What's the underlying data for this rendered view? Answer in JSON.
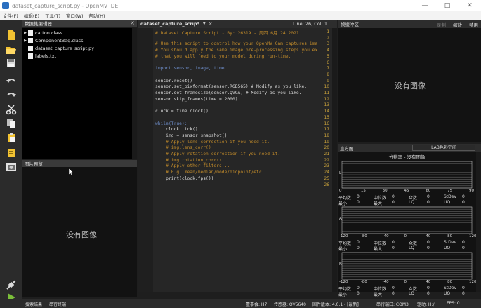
{
  "window": {
    "title": "dataset_capture_script.py - OpenMV IDE"
  },
  "menu": [
    "文件(F)",
    "编辑(E)",
    "工具(T)",
    "窗口(W)",
    "帮助(H)"
  ],
  "file_browser": {
    "header": "数据集编辑器",
    "items": [
      {
        "name": "carton.class",
        "folder": true
      },
      {
        "name": "ComponentBag.class",
        "folder": true
      },
      {
        "name": "dataset_capture_script.py",
        "folder": false
      },
      {
        "name": "labels.txt",
        "folder": false
      }
    ]
  },
  "image_preview": {
    "header": "图片预览",
    "no_image": "没有图像"
  },
  "editor": {
    "tab_label": "dataset_capture_scrip*",
    "line_col": "Line: 26, Col: 1",
    "lines": [
      "# Dataset Capture Script - By: 26319 - 周四 6月 24 2021",
      "",
      "# Use this script to control how your OpenMV Cam captures ima",
      "# You should apply the same image pre-processing steps you ex",
      "# that you will feed to your model during run-time.",
      "",
      "import sensor, image, time",
      "",
      "sensor.reset()",
      "sensor.set_pixformat(sensor.RGB565) # Modify as you like.",
      "sensor.set_framesize(sensor.QVGA) # Modify as you like.",
      "sensor.skip_frames(time = 2000)",
      "",
      "clock = time.clock()",
      "",
      "while(True):",
      "    clock.tick()",
      "    img = sensor.snapshot()",
      "    # Apply lens correction if you need it.",
      "    # img.lens_corr()",
      "    # Apply rotation correction if you need it.",
      "    # img.rotation_corr()",
      "    # Apply other filters...",
      "    # E.g. mean/median/mode/midpoint/etc.",
      "    print(clock.fps())",
      ""
    ]
  },
  "frame_buffer": {
    "header": "帧缓冲区",
    "record_label": "录制",
    "zoom_label": "缩放",
    "disable_label": "禁用",
    "no_image": "没有图像"
  },
  "histogram": {
    "header": "直方图",
    "color_space": "LAB色彩空间",
    "resolution_text": "分辨率 - 没有图像",
    "channel_labels": [
      "L",
      "A",
      "B"
    ],
    "ticks_l": [
      "0",
      "15",
      "30",
      "45",
      "60",
      "75",
      "90"
    ],
    "ticks_ab": [
      "-120",
      "-80",
      "-40",
      "0",
      "40",
      "80",
      "120"
    ],
    "stat_names": {
      "mean": "平均数",
      "median": "中位数",
      "mode": "众数",
      "stdev": "StDev",
      "min": "最小",
      "max": "最大",
      "lq": "LQ",
      "uq": "UQ"
    },
    "stat_value": "0"
  },
  "status_bar": {
    "search_results": "搜索结果",
    "serial_terminal": "串行终端",
    "firmware_label": "固件版本: 4.0.1 - [最新]",
    "board_label": "董事会: H7",
    "sensor_label": "传感器: OV5640",
    "serial_port": "串行端口: COM3",
    "drive": "驱动: H:/",
    "fps": "FPS: 0"
  },
  "colors": {
    "background": "#1e1e1e",
    "comment": "#c08a2a",
    "keyword": "#6d8cc7",
    "line_number": "#c9a23b",
    "toolbar_icon": "#f1c232"
  }
}
